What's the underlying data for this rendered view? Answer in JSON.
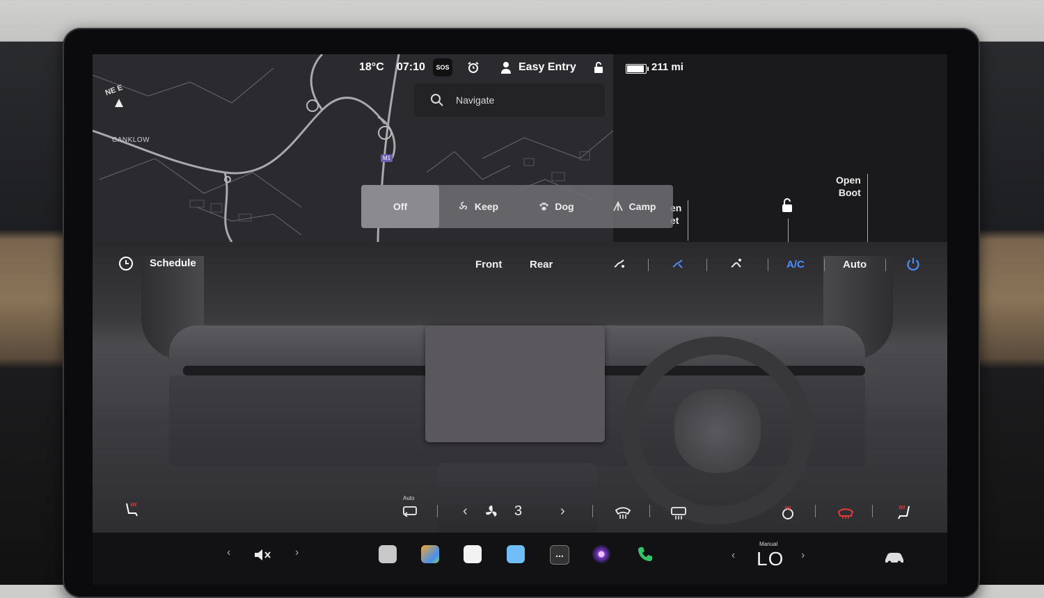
{
  "status": {
    "temperature": "18°C",
    "time": "07:10",
    "sos": "SOS",
    "profile": "Easy Entry",
    "range": "211 mi",
    "battery_level": 0.85
  },
  "map": {
    "compass": "NE E",
    "place_label": "CANKLOW",
    "road_badge": "M1"
  },
  "search": {
    "placeholder": "Navigate"
  },
  "car_panel": {
    "open_frunk": "en\net",
    "open_boot": "Open\nBoot"
  },
  "modes": [
    "Off",
    "Keep",
    "Dog",
    "Camp"
  ],
  "climate": {
    "schedule": "Schedule",
    "front": "Front",
    "rear": "Rear",
    "ac": "A/C",
    "auto": "Auto",
    "auto_small": "Auto",
    "fan_speed": "3"
  },
  "dock": {
    "temp_mode": "Manual",
    "temp_value": "LO",
    "more": "..."
  },
  "colors": {
    "accent_blue": "#4d8dff",
    "heat_red": "#e23b3b"
  }
}
